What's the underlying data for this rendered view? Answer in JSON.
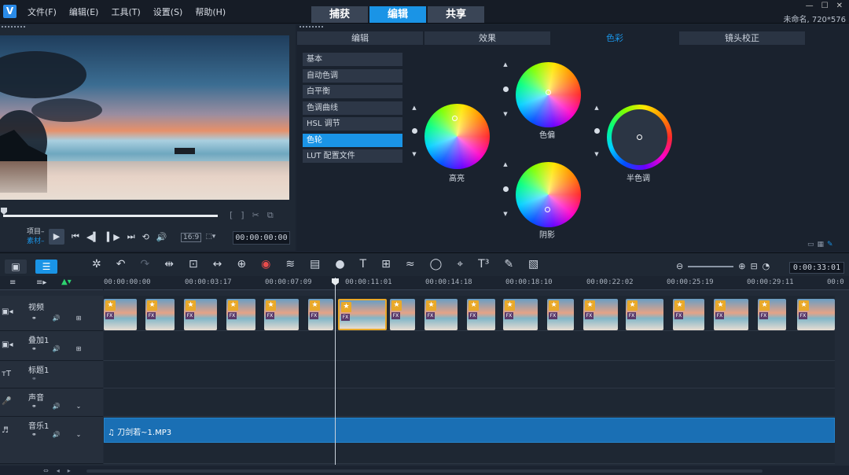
{
  "app": {
    "logo": "V",
    "project_info": "未命名, 720*576"
  },
  "menu": [
    "文件(F)",
    "编辑(E)",
    "工具(T)",
    "设置(S)",
    "帮助(H)"
  ],
  "modes": [
    {
      "label": "捕获",
      "active": false
    },
    {
      "label": "编辑",
      "active": true
    },
    {
      "label": "共享",
      "active": false
    }
  ],
  "window_controls": [
    "—",
    "☐",
    "✕"
  ],
  "preview": {
    "timecode": "00:00:00:00",
    "source_labels": [
      "项目–",
      "素材–"
    ],
    "aspect": "16:9",
    "mark_buttons": [
      "[",
      "]",
      "✂",
      "⧉"
    ],
    "controls": [
      "play-icon",
      "home-icon",
      "prev-frame-icon",
      "next-frame-icon",
      "end-icon",
      "repeat-icon",
      "volume-icon"
    ]
  },
  "panel": {
    "tabs": [
      {
        "label": "编辑",
        "active": false
      },
      {
        "label": "效果",
        "active": false
      },
      {
        "label": "色彩",
        "active": true
      },
      {
        "label": "镜头校正",
        "active": false
      }
    ],
    "options": [
      {
        "label": "基本",
        "active": false
      },
      {
        "label": "自动色调",
        "active": false
      },
      {
        "label": "白平衡",
        "active": false
      },
      {
        "label": "色调曲线",
        "active": false
      },
      {
        "label": "HSL 调节",
        "active": false
      },
      {
        "label": "色轮",
        "active": true
      },
      {
        "label": "LUT 配置文件",
        "active": false
      }
    ],
    "wheels": {
      "highlight": "高亮",
      "offset": "色偏",
      "shadow": "阴影",
      "midtone": "半色调"
    }
  },
  "timeline": {
    "total_time": "0:00:33:01",
    "ticks": [
      "00:00:00:00",
      "00:00:03:17",
      "00:00:07:09",
      "00:00:11:01",
      "00:00:14:18",
      "00:00:18:10",
      "00:00:22:02",
      "00:00:25:19",
      "00:00:29:11",
      "00:0"
    ],
    "tracks": [
      {
        "name": "视频",
        "icon": "video-track-icon"
      },
      {
        "name": "叠加1",
        "icon": "overlay-track-icon"
      },
      {
        "name": "标题1",
        "icon": "title-track-icon"
      },
      {
        "name": "声音",
        "icon": "voice-track-icon"
      },
      {
        "name": "音乐1",
        "icon": "music-track-icon"
      }
    ],
    "clip_badge": "★",
    "clip_fx": "FX",
    "audio_clip": "刀剑若~1.MP3"
  }
}
